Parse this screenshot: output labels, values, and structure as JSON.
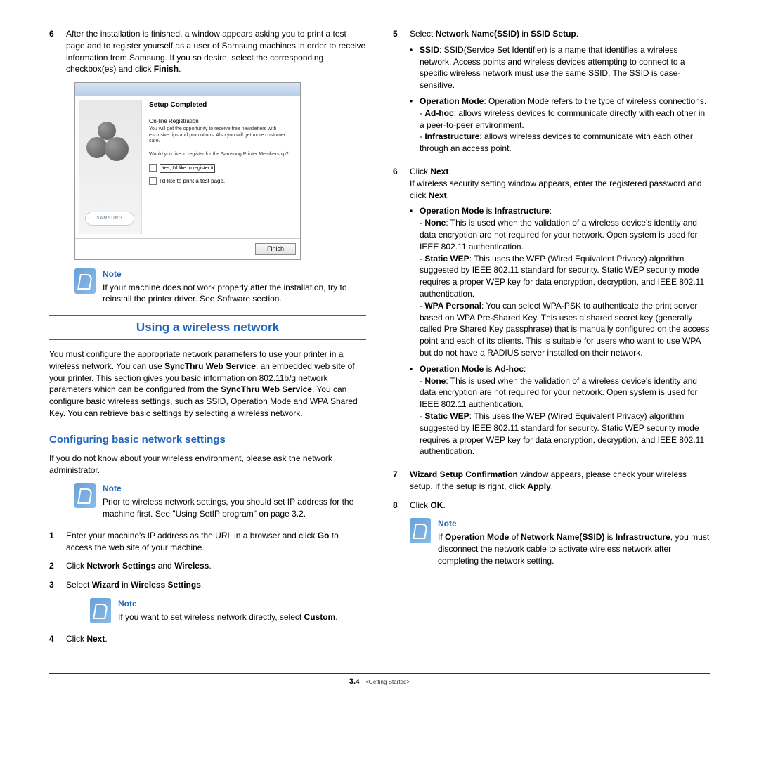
{
  "col1": {
    "step6": {
      "num": "6",
      "text_a": "After the installation is finished, a window appears asking you to print a test page and to register yourself as a user of Samsung machines in order to receive information from Samsung. If you so desire, select the corresponding checkbox(es) and click ",
      "text_b": "Finish",
      "text_c": "."
    },
    "screenshot": {
      "title": "Setup Completed",
      "sub": "On-line Registration",
      "line1": "You will get the opportunity to receive free newsletters with exclusive tips and promotions. Also you will get more customer care.",
      "line2": "Would you like to register for the Samsung Printer Membership?",
      "chk1": "Yes, I'd like to register it",
      "chk2": "I'd like to print a test page.",
      "logo": "SAMSUNG",
      "button": "Finish"
    },
    "note1": {
      "label": "Note",
      "text": "If your machine does not work properly after the installation, try to reinstall the printer driver. See Software section."
    },
    "section": "Using a wireless network",
    "intro_a": "You must configure the appropriate network parameters to use your printer in a wireless network. You can use ",
    "intro_b": "SyncThru Web Service",
    "intro_c": ", an embedded web site of your printer. This section gives you basic information on 802.11b/g network parameters which can be configured from the ",
    "intro_d": "SyncThru Web Service",
    "intro_e": ". You can configure basic wireless settings, such as SSID, Operation Mode and WPA Shared Key. You can retrieve basic settings by selecting a wireless network.",
    "subsection": "Configuring basic network settings",
    "para2": "If you do not know about your wireless environment, please ask the network administrator.",
    "note2": {
      "label": "Note",
      "text": "Prior to wireless network settings, you should set IP address for the machine first. See \"Using SetIP program\" on page 3.2."
    },
    "s1": {
      "n": "1",
      "a": "Enter your machine's IP address as the URL in a browser and click ",
      "b": "Go",
      "c": " to access the web site of your machine."
    },
    "s2": {
      "n": "2",
      "a": "Click ",
      "b": "Network Settings",
      "c": " and ",
      "d": "Wireless",
      "e": "."
    },
    "s3": {
      "n": "3",
      "a": "Select ",
      "b": "Wizard",
      "c": " in ",
      "d": "Wireless Settings",
      "e": "."
    },
    "note3": {
      "label": "Note",
      "a": "If you want to set wireless network directly, select ",
      "b": "Custom",
      "c": "."
    },
    "s4": {
      "n": "4",
      "a": "Click ",
      "b": "Next",
      "c": "."
    }
  },
  "col2": {
    "s5": {
      "n": "5",
      "a": "Select ",
      "b": "Network Name(SSID)",
      "c": " in ",
      "d": "SSID Setup",
      "e": "."
    },
    "b5_1": {
      "h": "SSID",
      "t": ": SSID(Service Set Identifier) is a name that identifies a wireless network. Access points and wireless devices attempting to connect to a specific wireless network must use the same SSID. The SSID is case-sensitive."
    },
    "b5_2": {
      "h": "Operation Mode",
      "t": ": Operation Mode refers to the type of wireless connections."
    },
    "b5_2a": {
      "h": "Ad-hoc",
      "t": ": allows wireless devices to communicate directly with each other in a peer-to-peer environment."
    },
    "b5_2b": {
      "h": "Infrastructure",
      "t": ": allows wireless devices to communicate with each other through an access point."
    },
    "s6": {
      "n": "6",
      "a": "Click ",
      "b": "Next",
      "c": ".",
      "d": "If wireless security setting window appears, enter the registered password and click ",
      "e": "Next",
      "f": "."
    },
    "b6a": {
      "h": "Operation Mode",
      "m": " is ",
      "v": "Infrastructure",
      "t": ":"
    },
    "b6a1": {
      "h": "None",
      "t": ": This is used when the validation of a wireless device's identity and data encryption are not required for your network. Open system is used for IEEE 802.11 authentication."
    },
    "b6a2": {
      "h": "Static WEP",
      "t": ": This uses the WEP (Wired Equivalent Privacy) algorithm suggested by IEEE 802.11 standard for security. Static WEP security mode requires a proper WEP key for data encryption, decryption, and IEEE 802.11 authentication."
    },
    "b6a3": {
      "h": "WPA Personal",
      "t": ": You can select WPA-PSK to authenticate the print server based on WPA Pre-Shared Key. This uses a shared secret key (generally called Pre Shared Key passphrase) that is manually configured on the access point and each of its clients. This is suitable for users who want to use WPA but do not have a RADIUS server installed on their network."
    },
    "b6b": {
      "h": "Operation Mode",
      "m": " is ",
      "v": "Ad-hoc",
      "t": ":"
    },
    "b6b1": {
      "h": "None",
      "t": ": This is used when the validation of a wireless device's identity and data encryption are not required for your network. Open system is used for IEEE 802.11 authentication."
    },
    "b6b2": {
      "h": "Static WEP",
      "t": ": This uses the WEP (Wired Equivalent Privacy) algorithm suggested by IEEE 802.11 standard for security. Static WEP security mode requires a proper WEP key for data encryption, decryption, and IEEE 802.11 authentication."
    },
    "s7": {
      "n": "7",
      "a": "Wizard Setup Confirmation",
      "b": " window appears, please check your wireless setup. If the setup is right, click ",
      "c": "Apply",
      "d": "."
    },
    "s8": {
      "n": "8",
      "a": "Click ",
      "b": "OK",
      "c": "."
    },
    "note4": {
      "label": "Note",
      "a": "If ",
      "b": "Operation Mode",
      "c": " of ",
      "d": "Network Name(SSID)",
      "e": " is ",
      "f": "Infrastructure",
      "g": ", you must disconnect the network cable to activate wireless network after completing the network setting."
    }
  },
  "footer": {
    "page": "3.",
    "num": "4",
    "chapter": "<Getting Started>"
  }
}
